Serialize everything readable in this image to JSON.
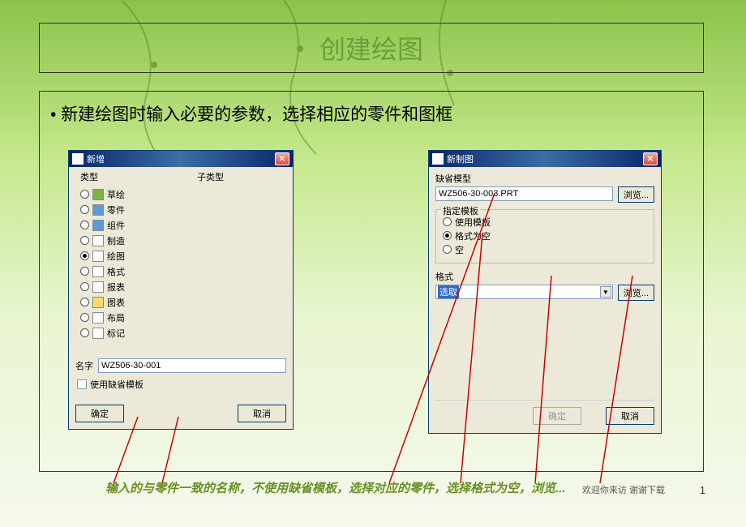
{
  "slide": {
    "title": "创建绘图",
    "bullet": "新建绘图时输入必要的参数，选择相应的零件和图框",
    "caption": "输入的与零件一致的名称，不使用缺省模板，选择对应的零件，选择格式为空，浏览...",
    "footer": "欢迎你来访   谢谢下载",
    "page": "1"
  },
  "dialog1": {
    "title": "新增",
    "type_header": "类型",
    "subtype_header": "子类型",
    "types": [
      {
        "label": "草绘"
      },
      {
        "label": "零件"
      },
      {
        "label": "组件"
      },
      {
        "label": "制造"
      },
      {
        "label": "绘图"
      },
      {
        "label": "格式"
      },
      {
        "label": "报表"
      },
      {
        "label": "图表"
      },
      {
        "label": "布局"
      },
      {
        "label": "标记"
      }
    ],
    "selected_type_index": 4,
    "name_label": "名字",
    "name_value": "WZ506-30-001",
    "use_default_label": "使用缺省模板",
    "ok": "确定",
    "cancel": "取消"
  },
  "dialog2": {
    "title": "新制图",
    "default_model_label": "缺省模型",
    "model_value": "WZ506-30-003.PRT",
    "browse": "浏览...",
    "template_group": "指定模板",
    "templates": [
      {
        "label": "使用模板"
      },
      {
        "label": "格式为空"
      },
      {
        "label": "空"
      }
    ],
    "selected_template_index": 1,
    "format_label": "格式",
    "format_value": "选取",
    "ok": "确定",
    "cancel": "取消"
  }
}
